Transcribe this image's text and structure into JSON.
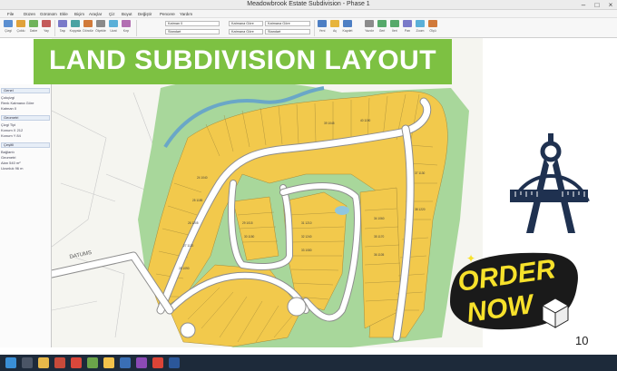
{
  "window": {
    "title": "Meadowbrook Estate Subdivision - Phase 1"
  },
  "menu": {
    "items": [
      "File",
      "Düzen",
      "Görünüm",
      "Ekle",
      "Biçim",
      "Araçlar",
      "Çiz",
      "Boyut",
      "Değiştir",
      "Pencere",
      "Yardım"
    ]
  },
  "ribbon": {
    "labels": [
      "Çizgi",
      "Çoklu",
      "Daire",
      "Yay",
      "Taşı",
      "Kopyala",
      "Döndür",
      "Ölçekle",
      "Uzat",
      "Kırp"
    ],
    "layer_combo": "Katman 0",
    "style_combo": "Standart",
    "color_combo": "Katmana Göre",
    "linetype_combo": "Katmana Göre",
    "right_labels": [
      "Yeni",
      "Aç",
      "Kaydet",
      "Yazdır",
      "Geri",
      "İleri",
      "Pan",
      "Zoom",
      "Ölçü"
    ]
  },
  "banner": {
    "title": "LAND SUBDIVISION LAYOUT",
    "color": "#7dc142"
  },
  "properties_panel": {
    "rows": [
      "Çokçizgi",
      "Renk  Katmana Göre",
      "Katman  0",
      "Çizgi Tipi",
      "Konum X  212",
      "Konum Y  84",
      "Bağlantı",
      "Geometri",
      "Alan  540 m²",
      "Uzunluk  96 m"
    ],
    "headers": [
      "Genel",
      "Geometri",
      "Çeşitli"
    ]
  },
  "map": {
    "lot_color": "#f2c94c",
    "green_color": "#a8d79b",
    "road_color": "#ffffff",
    "street_label": "DATUMS",
    "lot_labels": [
      "24 1040",
      "25 1185",
      "26 1205",
      "27 1120",
      "28 1090",
      "29 1015",
      "30 1150",
      "31 1210",
      "32 1240",
      "33 1080",
      "34 1060",
      "35 1170",
      "36 1105",
      "37 1130",
      "38 1220",
      "39 1045",
      "40 1190"
    ]
  },
  "badge": {
    "order_line1": "ORDER",
    "order_line2": "NOW",
    "badge_bg": "#1a1a1a",
    "badge_text": "#f7e12b"
  },
  "page_number": "10",
  "taskbar": {
    "apps": [
      "windows-icon",
      "search-icon",
      "file-explorer-icon",
      "browser-icon",
      "cad-icon",
      "mail-icon",
      "photos-icon",
      "store-icon",
      "settings-icon",
      "chrome-icon",
      "word-icon"
    ]
  }
}
